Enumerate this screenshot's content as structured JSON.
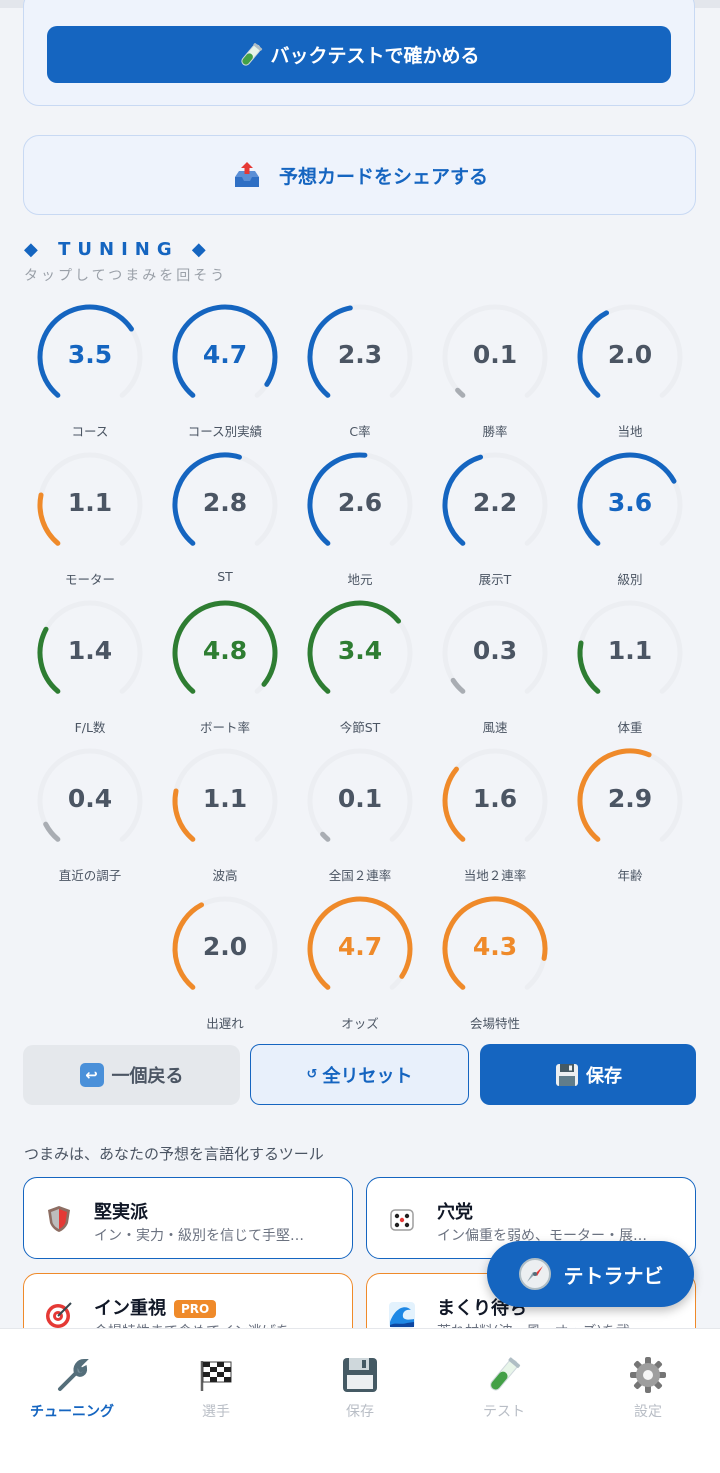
{
  "actions": {
    "backtest_label": "バックテストで確かめる",
    "share_label": "予想カードをシェアする"
  },
  "tuning": {
    "heading": "◆ TUNING ◆",
    "subtitle": "タップしてつまみを回そう",
    "knobs": [
      {
        "label": "コース",
        "value": "3.5",
        "level": 0.7,
        "color": "#1565c0"
      },
      {
        "label": "コース別実績",
        "value": "4.7",
        "level": 0.94,
        "color": "#1565c0"
      },
      {
        "label": "C率",
        "value": "2.3",
        "level": 0.46,
        "color": "#4b5563"
      },
      {
        "label": "勝率",
        "value": "0.1",
        "level": 0.02,
        "color": "#4b5563"
      },
      {
        "label": "当地",
        "value": "2.0",
        "level": 0.4,
        "color": "#4b5563"
      },
      {
        "label": "モーター",
        "value": "1.1",
        "level": 0.22,
        "color": "#4b5563"
      },
      {
        "label": "ST",
        "value": "2.8",
        "level": 0.56,
        "color": "#4b5563"
      },
      {
        "label": "地元",
        "value": "2.6",
        "level": 0.52,
        "color": "#4b5563"
      },
      {
        "label": "展示T",
        "value": "2.2",
        "level": 0.44,
        "color": "#4b5563"
      },
      {
        "label": "級別",
        "value": "3.6",
        "level": 0.72,
        "color": "#1565c0"
      },
      {
        "label": "F/L数",
        "value": "1.4",
        "level": 0.28,
        "color": "#4b5563"
      },
      {
        "label": "ボート率",
        "value": "4.8",
        "level": 0.96,
        "color": "#2e7d32"
      },
      {
        "label": "今節ST",
        "value": "3.4",
        "level": 0.68,
        "color": "#2e7d32"
      },
      {
        "label": "風速",
        "value": "0.3",
        "level": 0.06,
        "color": "#4b5563"
      },
      {
        "label": "体重",
        "value": "1.1",
        "level": 0.22,
        "color": "#4b5563"
      },
      {
        "label": "直近の調子",
        "value": "0.4",
        "level": 0.08,
        "color": "#4b5563"
      },
      {
        "label": "波高",
        "value": "1.1",
        "level": 0.22,
        "color": "#4b5563"
      },
      {
        "label": "全国２連率",
        "value": "0.1",
        "level": 0.02,
        "color": "#4b5563"
      },
      {
        "label": "当地２連率",
        "value": "1.6",
        "level": 0.32,
        "color": "#4b5563"
      },
      {
        "label": "年齢",
        "value": "2.9",
        "level": 0.58,
        "color": "#4b5563"
      },
      {
        "label": "出遅れ",
        "value": "2.0",
        "level": 0.4,
        "color": "#4b5563"
      },
      {
        "label": "オッズ",
        "value": "4.7",
        "level": 0.94,
        "color": "#ef8a2a"
      },
      {
        "label": "会場特性",
        "value": "4.3",
        "level": 0.86,
        "color": "#ef8a2a"
      }
    ]
  },
  "controls": {
    "undo_label": "一個戻る",
    "reset_icon": "↺",
    "reset_label": "全リセット",
    "save_label": "保存"
  },
  "tools": {
    "caption": "つまみは、あなたの予想を言語化するツール",
    "presets": [
      {
        "title": "堅実派",
        "desc": "イン・実力・級別を信じて手堅…",
        "icon": "shield-icon"
      },
      {
        "title": "穴党",
        "desc": "イン偏重を弱め、モーター・展…",
        "icon": "dice-icon"
      },
      {
        "title": "イン重視",
        "badge": "PRO",
        "desc": "会場特性まで含めてイン逃げを",
        "icon": "target-icon"
      },
      {
        "title": "まくり待ち",
        "desc": "荒れ材料(波・風・オッズ)を武",
        "icon": "wave-icon"
      }
    ]
  },
  "fab": {
    "label": "テトラナビ"
  },
  "tabs": [
    {
      "label": "チューニング",
      "active": true
    },
    {
      "label": "選手"
    },
    {
      "label": "保存"
    },
    {
      "label": "テスト"
    },
    {
      "label": "設定"
    }
  ],
  "colors": {
    "primary": "#1565c0",
    "green": "#2e7d32",
    "orange": "#ef8a2a",
    "track": "#eceef2",
    "neutral_value": "#4b5563"
  }
}
